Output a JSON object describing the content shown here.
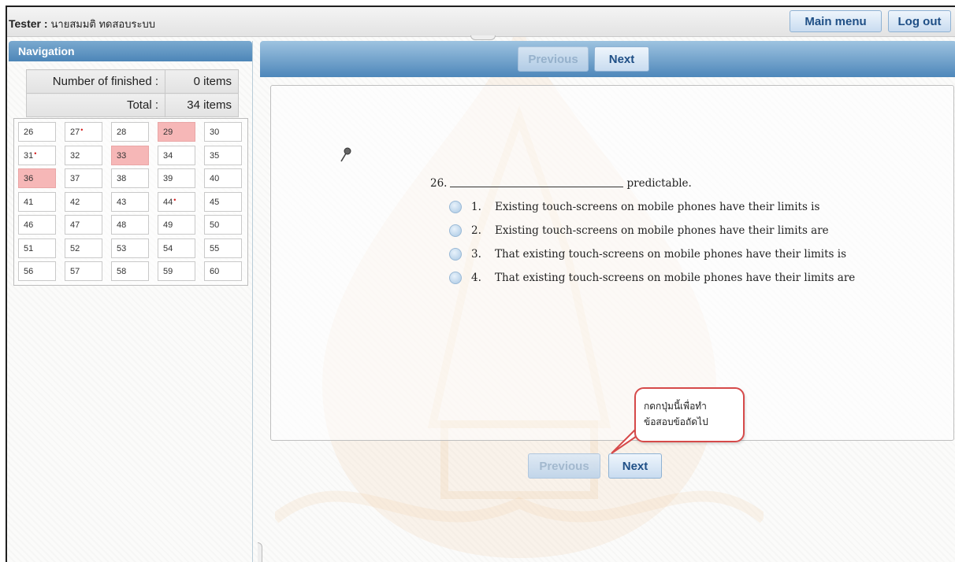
{
  "header": {
    "tester_label": "Tester :",
    "tester_name": "นายสมมติ ทดสอบระบบ",
    "main_menu": "Main menu",
    "log_out": "Log out"
  },
  "nav": {
    "title": "Navigation",
    "finished_label": "Number of finished :",
    "finished_value": "0 items",
    "total_label": "Total :",
    "total_value": "34 items",
    "cells": [
      {
        "n": "26"
      },
      {
        "n": "27",
        "pin": "pushpin"
      },
      {
        "n": "28"
      },
      {
        "n": "29",
        "highlight": "#f6b7b7"
      },
      {
        "n": "30"
      },
      {
        "n": "31",
        "pin": "pushpin"
      },
      {
        "n": "32"
      },
      {
        "n": "33",
        "highlight": "#f6b7b7"
      },
      {
        "n": "34"
      },
      {
        "n": "35"
      },
      {
        "n": "36",
        "highlight": "#f6b7b7"
      },
      {
        "n": "37"
      },
      {
        "n": "38"
      },
      {
        "n": "39"
      },
      {
        "n": "40"
      },
      {
        "n": "41"
      },
      {
        "n": "42"
      },
      {
        "n": "43"
      },
      {
        "n": "44",
        "pin": "pushpin"
      },
      {
        "n": "45"
      },
      {
        "n": "46"
      },
      {
        "n": "47"
      },
      {
        "n": "48"
      },
      {
        "n": "49"
      },
      {
        "n": "50"
      },
      {
        "n": "51"
      },
      {
        "n": "52"
      },
      {
        "n": "53"
      },
      {
        "n": "54"
      },
      {
        "n": "55"
      },
      {
        "n": "56"
      },
      {
        "n": "57"
      },
      {
        "n": "58"
      },
      {
        "n": "59"
      },
      {
        "n": "60"
      }
    ]
  },
  "main": {
    "previous_label": "Previous",
    "next_label": "Next",
    "question": {
      "number": "26.",
      "suffix": "predictable.",
      "options": [
        {
          "num": "1.",
          "text": "Existing touch-screens on mobile phones have their limits is"
        },
        {
          "num": "2.",
          "text": "Existing touch-screens on mobile phones have their limits are"
        },
        {
          "num": "3.",
          "text": "That existing touch-screens on mobile phones have their limits is"
        },
        {
          "num": "4.",
          "text": "That existing touch-screens on mobile phones have their limits are"
        }
      ]
    },
    "callout_text": "กดกปุ่มนี้เพื่อทำข้อสอบข้อถัดไป"
  },
  "colors": {
    "accent": "#4e87ba",
    "highlight": "#f6b7b7",
    "pin": "#d21b1b",
    "callout_border": "#d64a4a"
  }
}
